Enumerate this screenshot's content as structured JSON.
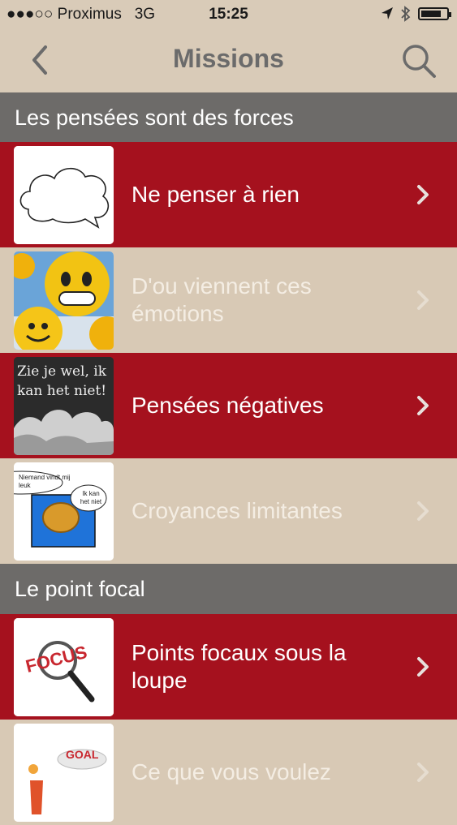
{
  "status": {
    "carrier": "●●●○○ Proximus",
    "network": "3G",
    "time": "15:25"
  },
  "nav": {
    "title": "Missions",
    "back_icon": "chevron-left-icon",
    "search_icon": "search-icon"
  },
  "sections": [
    {
      "title": "Les pensées sont des forces",
      "items": [
        {
          "label": "Ne penser à rien",
          "style": "red",
          "thumb": "cloud-illustration"
        },
        {
          "label": "D'ou viennent ces émotions",
          "style": "tan",
          "thumb": "smiley-faces-illustration"
        },
        {
          "label": "Pensées négatives",
          "style": "red",
          "thumb": "chalk-text-clouds-illustration",
          "thumb_text": "Zie je wel, ik kan het niet!"
        },
        {
          "label": "Croyances limitantes",
          "style": "tan",
          "thumb": "brain-speech-bubbles-illustration",
          "bubble_a": "Niemand vindt mij leuk",
          "bubble_b": "Ik kan het niet"
        }
      ]
    },
    {
      "title": "Le point focal",
      "items": [
        {
          "label": "Points focaux sous la loupe",
          "style": "red",
          "thumb": "focus-magnifier-illustration",
          "thumb_text": "FOCUS"
        },
        {
          "label": "Ce que vous voulez",
          "style": "tan",
          "thumb": "goal-illustration",
          "thumb_text": "GOAL"
        }
      ]
    }
  ],
  "colors": {
    "red_row": "#a5111e",
    "tan_row": "#d8c9b5",
    "section_header": "#6d6b69",
    "nav_title": "#6b6b6b"
  }
}
